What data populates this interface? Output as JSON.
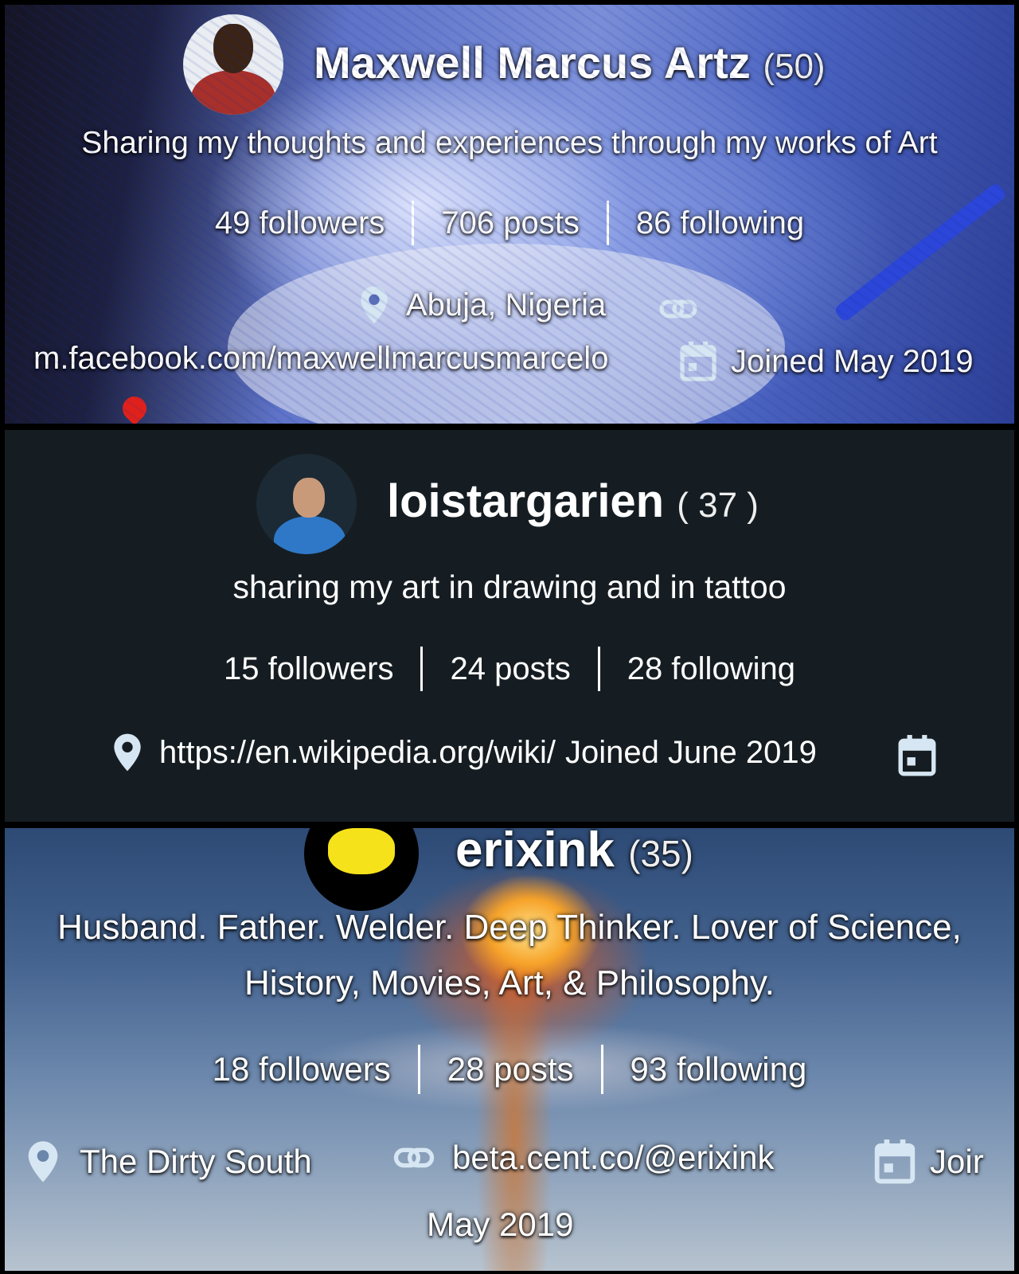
{
  "profiles": [
    {
      "name": "Maxwell Marcus Artz",
      "count": "(50)",
      "bio": "Sharing my thoughts and experiences through my works of Art",
      "followers": "49 followers",
      "posts": "706 posts",
      "following": "86 following",
      "location": "Abuja, Nigeria",
      "link": "m.facebook.com/maxwellmarcusmarcelo",
      "joined": "Joined May 2019"
    },
    {
      "name": "loistargarien",
      "count": "( 37 )",
      "bio": "sharing my art in drawing and in tattoo",
      "followers": "15 followers",
      "posts": "24 posts",
      "following": "28 following",
      "location": "https://en.wikipedia.org/wiki/",
      "joined": "Joined June 2019"
    },
    {
      "name": "erixink",
      "count": "(35)",
      "bio_line1": "Husband. Father. Welder. Deep Thinker. Lover of Science,",
      "bio_line2": "History, Movies, Art, & Philosophy.",
      "followers": "18 followers",
      "posts": "28 posts",
      "following": "93 following",
      "location": "The Dirty South",
      "link": "beta.cent.co/@erixink",
      "joined_part1": "Joir",
      "joined_part2": "May 2019"
    }
  ],
  "icons": {
    "location": "map-pin-icon",
    "link": "link-icon",
    "calendar": "calendar-icon"
  },
  "colors": {
    "icon": "#d6e6f2",
    "card2_bg": "#151d22"
  }
}
